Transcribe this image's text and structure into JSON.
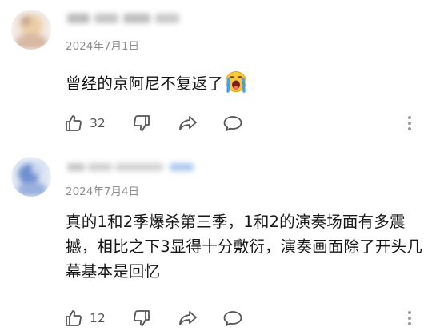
{
  "comments": [
    {
      "date": "2024年7月1日",
      "text": "曾经的京阿尼不复返了",
      "emoji": "crying-face-emoji",
      "likes": "32"
    },
    {
      "date": "2024年7月4日",
      "text": "真的1和2季爆杀第三季，1和2的演奏场面有多震撼，相比之下3显得十分敷衍，演奏画面除了开头几幕基本是回忆",
      "likes": "12"
    }
  ],
  "colors": {
    "icon": "#555555",
    "date": "#8e8e8e",
    "text": "#161616"
  },
  "icons": [
    "thumb-up-icon",
    "thumb-down-icon",
    "share-icon",
    "comment-icon",
    "more-vertical-icon"
  ]
}
